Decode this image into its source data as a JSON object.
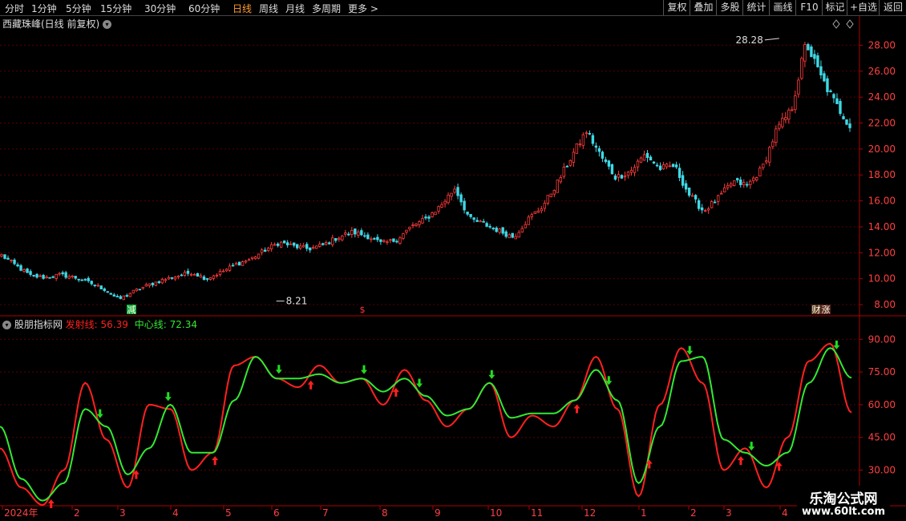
{
  "toolbar": {
    "periods": [
      "分时",
      "1分钟",
      "5分钟",
      "15分钟",
      "30分钟",
      "60分钟",
      "日线",
      "周线",
      "月线",
      "多周期",
      "更多"
    ],
    "active_period": "日线",
    "right_buttons": [
      "复权",
      "叠加",
      "多股",
      "统计",
      "画线",
      "F10",
      "标记",
      "+自选",
      "返回"
    ]
  },
  "main_panel": {
    "title": "西藏珠峰(日线 前复权)",
    "high_label": "28.28",
    "low_label": "8.21",
    "markers": [
      "减",
      "$",
      "财",
      "涨"
    ]
  },
  "indicator_panel": {
    "name": "股朋指标网",
    "line1_label": "发射线:",
    "line1_value": "56.39",
    "line2_label": "中心线:",
    "line2_value": "72.34"
  },
  "watermark": {
    "line1": "乐淘公式网",
    "line2": "www.60lt.com"
  },
  "colors": {
    "up": "#ff3b3b",
    "down": "#3fd9e6",
    "grid": "#5a0000",
    "axis": "#b00000",
    "signal": "#ff2020",
    "center": "#33e833"
  },
  "chart_data": [
    {
      "type": "candlestick",
      "title": "西藏珠峰(日线 前复权)",
      "ylim": [
        7.2,
        29.2
      ],
      "yticks": [
        8.0,
        10.0,
        12.0,
        14.0,
        16.0,
        18.0,
        20.0,
        22.0,
        24.0,
        26.0,
        28.0
      ],
      "x_labels": [
        "2024年",
        "2",
        "3",
        "4",
        "5",
        "6",
        "7",
        "8",
        "9",
        "10",
        "11",
        "12",
        "1",
        "2",
        "3",
        "4"
      ],
      "close_path": [
        11.8,
        11.0,
        10.2,
        10.1,
        10.3,
        10.1,
        9.7,
        9.2,
        8.4,
        9.0,
        9.5,
        9.9,
        10.2,
        10.5,
        10.0,
        10.5,
        11.1,
        11.5,
        12.2,
        12.8,
        12.5,
        12.3,
        12.6,
        13.2,
        13.6,
        13.3,
        12.7,
        13.0,
        14.0,
        14.6,
        15.6,
        17.0,
        14.6,
        14.2,
        13.7,
        13.2,
        14.6,
        15.6,
        17.4,
        19.5,
        21.4,
        19.4,
        17.8,
        18.3,
        19.6,
        18.5,
        18.7,
        16.5,
        15.2,
        16.2,
        17.5,
        17.2,
        18.5,
        21.5,
        23.0,
        28.2,
        25.6,
        23.5,
        21.8
      ]
    },
    {
      "type": "line",
      "title": "股朋指标网",
      "ylim": [
        14.0,
        96.0
      ],
      "yticks": [
        30.0,
        45.0,
        60.0,
        75.0,
        90.0
      ],
      "series": [
        {
          "name": "发射线",
          "values": [
            40,
            22,
            14,
            30,
            70,
            44,
            22,
            60,
            58,
            30,
            38,
            78,
            82,
            72,
            68,
            78,
            70,
            72,
            60,
            76,
            62,
            50,
            58,
            70,
            45,
            55,
            50,
            62,
            82,
            58,
            18,
            60,
            86,
            70,
            30,
            40,
            22,
            45,
            80,
            88,
            56.39
          ]
        },
        {
          "name": "中心线",
          "values": [
            50,
            26,
            16,
            24,
            58,
            50,
            28,
            40,
            60,
            38,
            38,
            62,
            82,
            72,
            72,
            74,
            70,
            72,
            66,
            72,
            64,
            55,
            58,
            70,
            54,
            56,
            56,
            62,
            76,
            62,
            24,
            50,
            80,
            82,
            44,
            38,
            32,
            38,
            70,
            86,
            72.34
          ]
        }
      ]
    }
  ]
}
